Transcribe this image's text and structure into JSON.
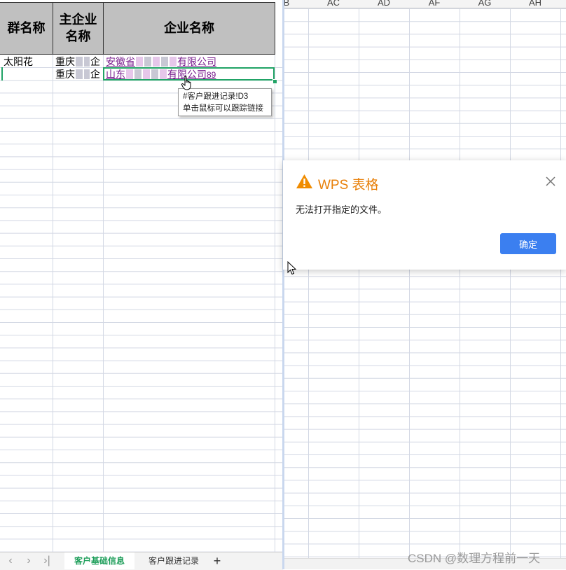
{
  "left_sheet": {
    "headers": {
      "col1": "群名称",
      "col2_line1": "主企业",
      "col2_line2": "名称",
      "col3": "企业名称"
    },
    "rows": [
      {
        "group": "太阳花",
        "main_prefix": "重庆",
        "main_suffix": "企",
        "company_prefix": "安徽省",
        "company_suffix": "有限公司"
      },
      {
        "group": "",
        "main_prefix": "重庆",
        "main_suffix": "企",
        "company_prefix": "山东",
        "company_suffix": "有限公司",
        "company_extra": "89"
      }
    ],
    "tooltip": {
      "line1": "#客户跟进记录!D3",
      "line2": "单击鼠标可以跟踪链接"
    }
  },
  "sheet_tabs": {
    "active": "客户基础信息",
    "second": "客户跟进记录",
    "add": "+"
  },
  "right_sheet": {
    "columns": [
      "B",
      "AC",
      "AD",
      "AF",
      "AG",
      "AH"
    ]
  },
  "dialog": {
    "title": "WPS 表格",
    "message": "无法打开指定的文件。",
    "ok_label": "确定"
  },
  "watermark": "CSDN @数理方程前一天",
  "colors": {
    "header_gray": "#c0c0c0",
    "selection_green": "#21a366",
    "link_purple": "#7a1f8f",
    "dialog_title_orange": "#e8800a",
    "ok_button_blue": "#3b7ff0"
  }
}
